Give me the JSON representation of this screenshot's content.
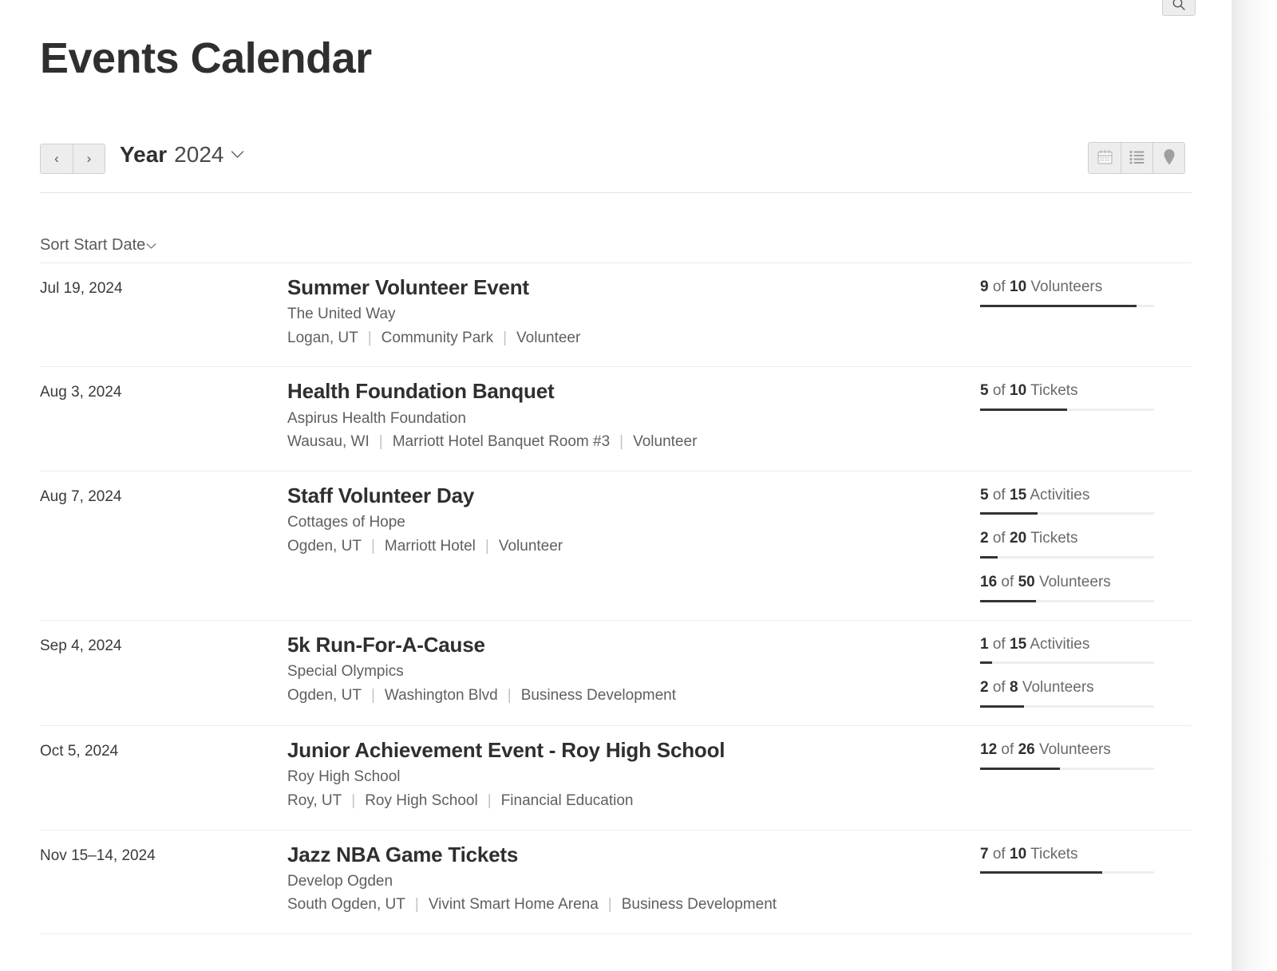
{
  "header": {
    "title": "Events Calendar",
    "search_icon": "search-icon"
  },
  "toolbar": {
    "prev_label": "‹",
    "next_label": "›",
    "period_label": "Year",
    "period_value": "2024",
    "period_caret": "⌄",
    "views": [
      {
        "name": "calendar-view",
        "icon": "calendar-icon",
        "selected": false
      },
      {
        "name": "list-view",
        "icon": "list-icon",
        "selected": true
      },
      {
        "name": "map-view",
        "icon": "map-pin-icon",
        "selected": false
      }
    ]
  },
  "sort": {
    "label": "Sort Start Date",
    "caret": "⌄"
  },
  "events": [
    {
      "date": "Jul 19, 2024",
      "title": "Summer Volunteer Event",
      "org": "The United Way",
      "location": "Logan, UT",
      "venue": "Community Park",
      "category": "Volunteer",
      "stats": [
        {
          "current": "9",
          "of": "of",
          "total": "10",
          "unit": "Volunteers",
          "percent": 90
        }
      ]
    },
    {
      "date": "Aug 3, 2024",
      "title": "Health Foundation Banquet",
      "org": "Aspirus Health Foundation",
      "location": "Wausau, WI",
      "venue": "Marriott Hotel Banquet Room #3",
      "category": "Volunteer",
      "stats": [
        {
          "current": "5",
          "of": "of",
          "total": "10",
          "unit": "Tickets",
          "percent": 50
        }
      ]
    },
    {
      "date": "Aug 7, 2024",
      "title": "Staff Volunteer Day",
      "org": "Cottages of Hope",
      "location": "Ogden, UT",
      "venue": "Marriott Hotel",
      "category": "Volunteer",
      "stats": [
        {
          "current": "5",
          "of": "of",
          "total": "15",
          "unit": "Activities",
          "percent": 33
        },
        {
          "current": "2",
          "of": "of",
          "total": "20",
          "unit": "Tickets",
          "percent": 10
        },
        {
          "current": "16",
          "of": "of",
          "total": "50",
          "unit": "Volunteers",
          "percent": 32
        }
      ]
    },
    {
      "date": "Sep 4, 2024",
      "title": "5k Run-For-A-Cause",
      "org": "Special Olympics",
      "location": "Ogden, UT",
      "venue": "Washington Blvd",
      "category": "Business Development",
      "stats": [
        {
          "current": "1",
          "of": "of",
          "total": "15",
          "unit": "Activities",
          "percent": 7
        },
        {
          "current": "2",
          "of": "of",
          "total": "8",
          "unit": "Volunteers",
          "percent": 25
        }
      ]
    },
    {
      "date": "Oct 5, 2024",
      "title": "Junior Achievement Event - Roy High School",
      "org": "Roy High School",
      "location": "Roy, UT",
      "venue": "Roy High School",
      "category": "Financial Education",
      "stats": [
        {
          "current": "12",
          "of": "of",
          "total": "26",
          "unit": "Volunteers",
          "percent": 46
        }
      ]
    },
    {
      "date": "Nov 15–14, 2024",
      "title": "Jazz NBA Game Tickets",
      "org": "Develop Ogden",
      "location": "South Ogden, UT",
      "venue": "Vivint Smart Home Arena",
      "category": "Business Development",
      "stats": [
        {
          "current": "7",
          "of": "of",
          "total": "10",
          "unit": "Tickets",
          "percent": 70
        }
      ]
    }
  ],
  "colors": {
    "bar_fill": "#333333",
    "bar_track": "#eeeeee",
    "text_primary": "#2f2f2f",
    "text_secondary": "#5f5f5f"
  }
}
